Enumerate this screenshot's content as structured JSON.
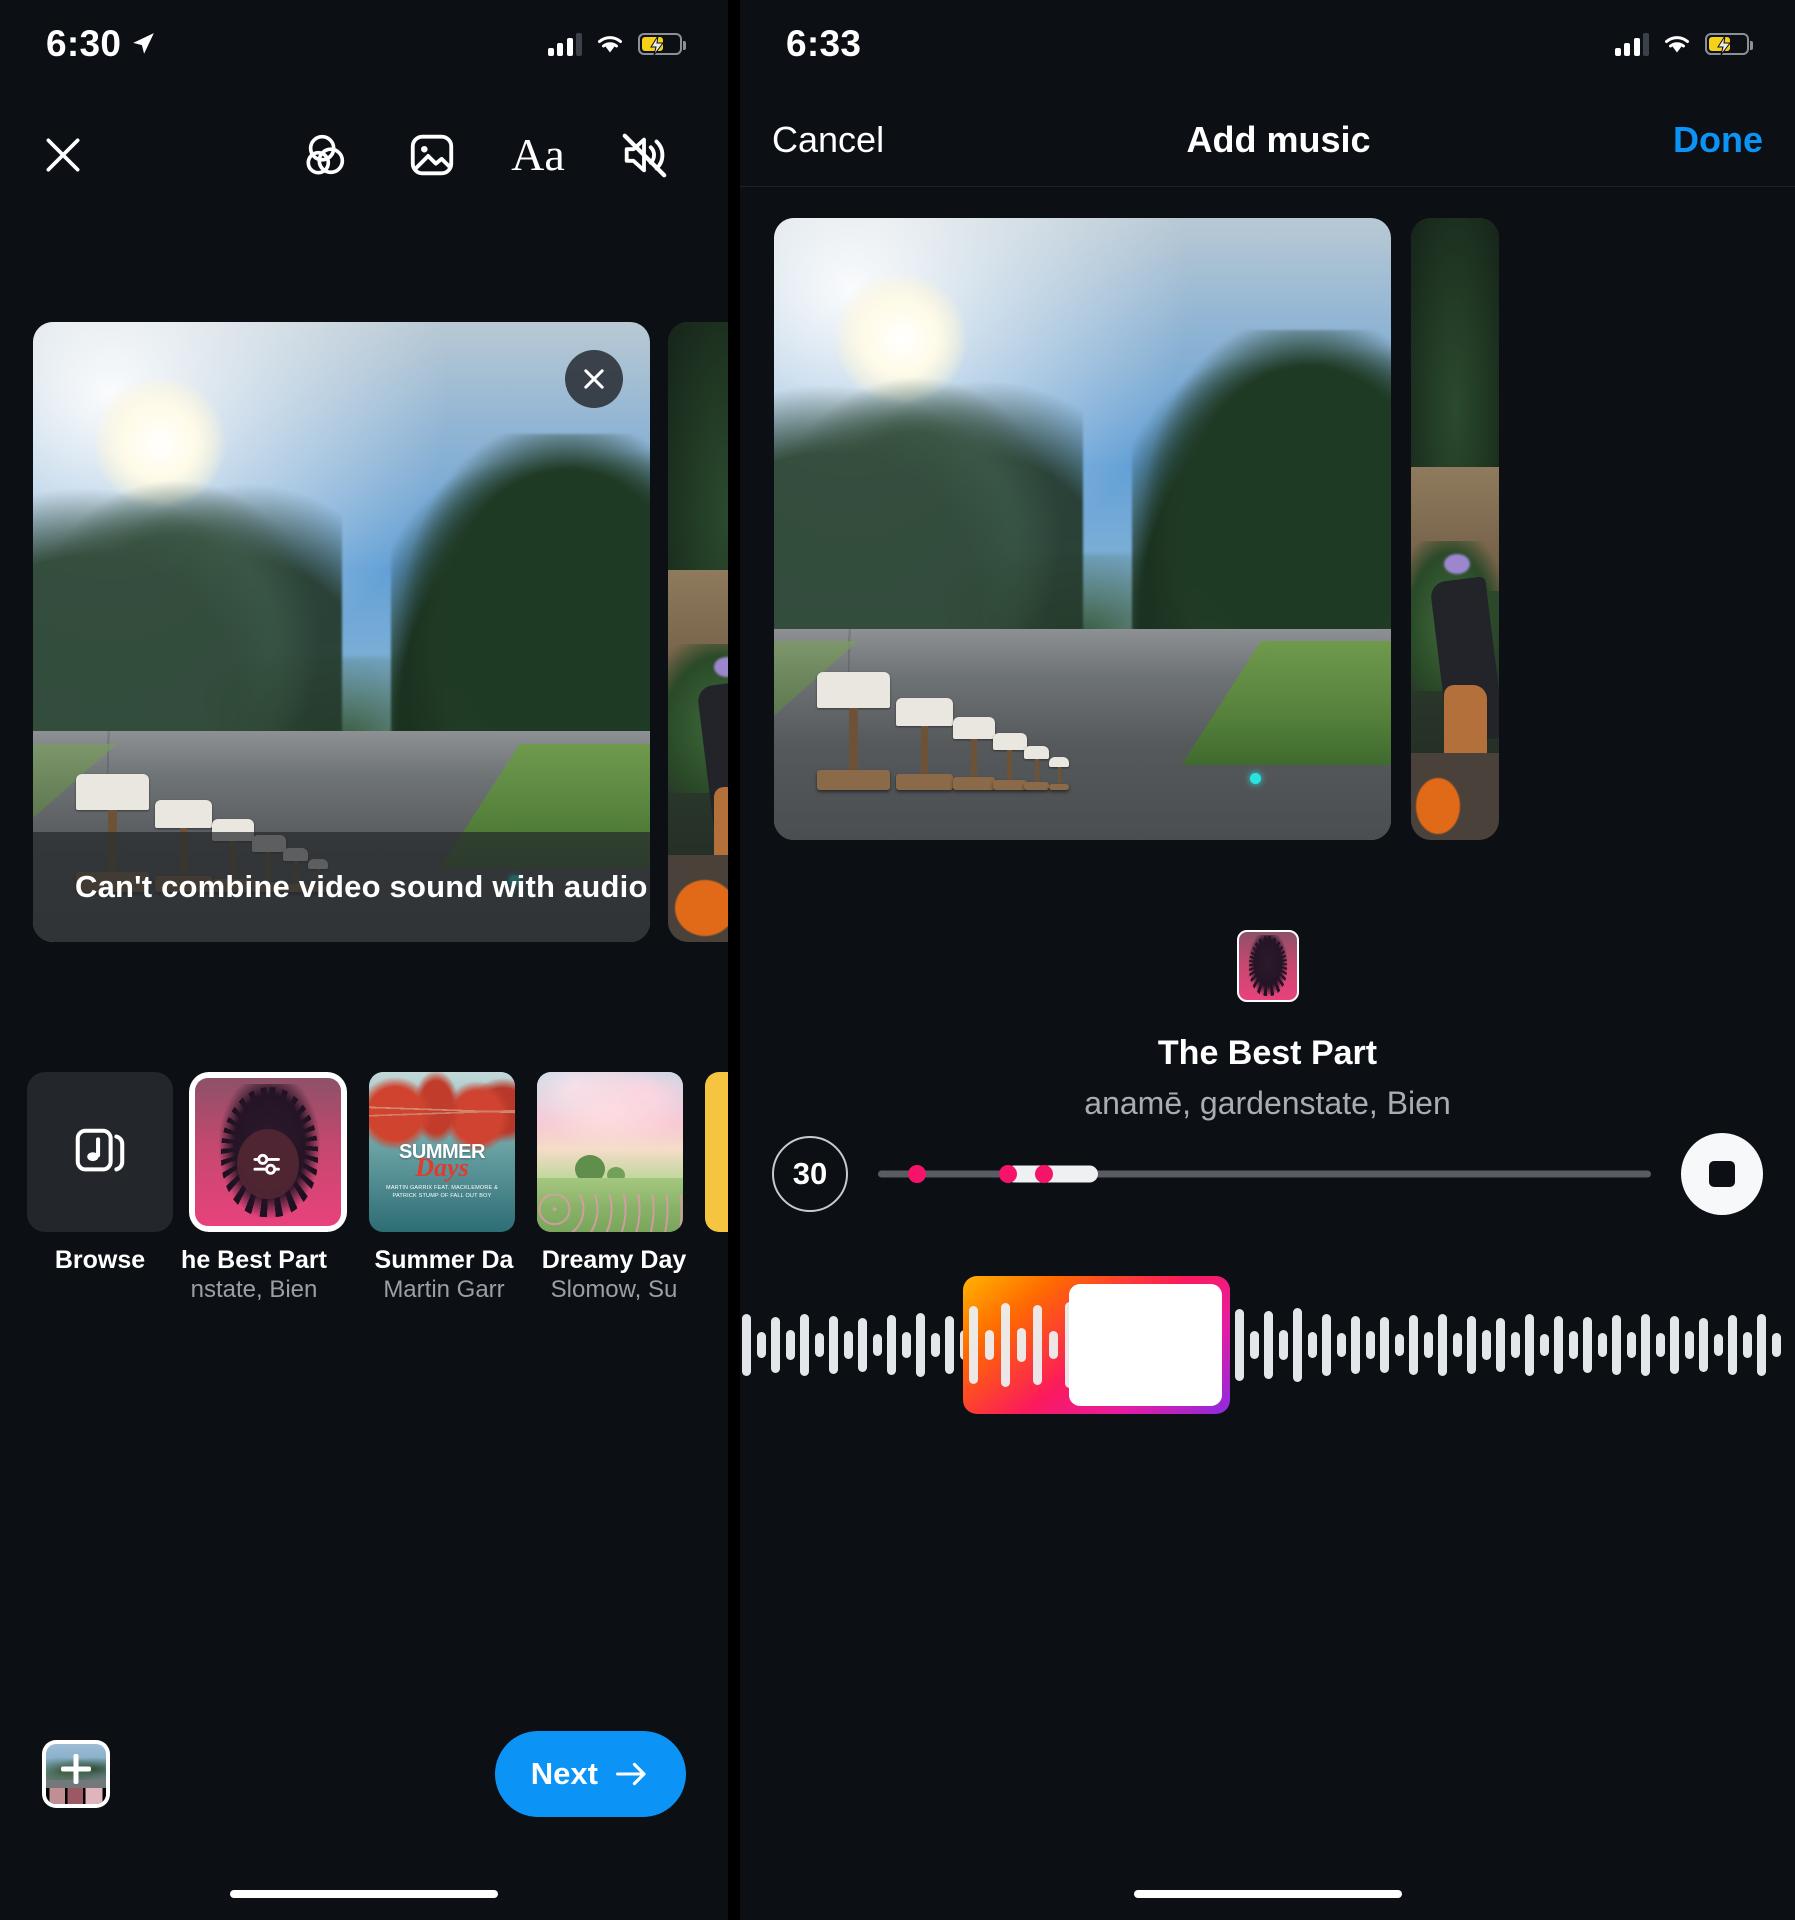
{
  "left_screen": {
    "status_bar": {
      "time": "6:30",
      "location_icon": "location-arrow-icon",
      "signal_icon": "cellular-bars-icon",
      "wifi_icon": "wifi-icon",
      "battery_icon": "battery-charging-icon"
    },
    "toolbar": {
      "close_label": "close-icon",
      "items": [
        {
          "name": "effects-icon",
          "label": ""
        },
        {
          "name": "sticker-image-icon",
          "label": ""
        },
        {
          "name": "text-icon",
          "label": "Aa"
        },
        {
          "name": "mute-icon",
          "label": ""
        }
      ]
    },
    "preview": {
      "close_button": "close-icon",
      "caption": "Can't combine video sound with audio track."
    },
    "music_carousel": [
      {
        "name": "browse",
        "icon": "music-library-icon",
        "title": "Browse",
        "artist": "",
        "selected": false
      },
      {
        "name": "the-best-part",
        "title": "he Best Part",
        "artist": "nstate, Bien",
        "selected": true,
        "overlay_icon": "mix-sliders-icon"
      },
      {
        "name": "summer-days",
        "title": "Summer Da",
        "artist": "Martin Garr",
        "selected": false,
        "art_text_1": "SUMMER",
        "art_text_2": "Days",
        "art_credit": "MARTIN GARRIX FEAT. MACKLEMORE & PATRICK STUMP OF FALL OUT BOY"
      },
      {
        "name": "dreamy-days",
        "title": "Dreamy Day",
        "artist": "Slomow, Su",
        "selected": false
      },
      {
        "name": "sticker-track",
        "title": "",
        "artist": "",
        "selected": false
      }
    ],
    "bottom_bar": {
      "gallery_button": "add-media-icon",
      "next_label": "Next",
      "next_arrow": "arrow-right-icon"
    }
  },
  "right_screen": {
    "status_bar": {
      "time": "6:33",
      "signal_icon": "cellular-bars-icon",
      "wifi_icon": "wifi-icon",
      "battery_icon": "battery-charging-icon"
    },
    "nav": {
      "cancel": "Cancel",
      "title": "Add music",
      "done": "Done",
      "done_color": "#0b93f6"
    },
    "song": {
      "title": "The Best Part",
      "artists": "anamē, gardenstate, Bien",
      "album_art": "the-best-part-album-art"
    },
    "controls": {
      "duration_seconds": "30",
      "stop_button": "stop-icon",
      "scrubber": "clip-position-scrubber",
      "waveform": "audio-waveform"
    }
  }
}
